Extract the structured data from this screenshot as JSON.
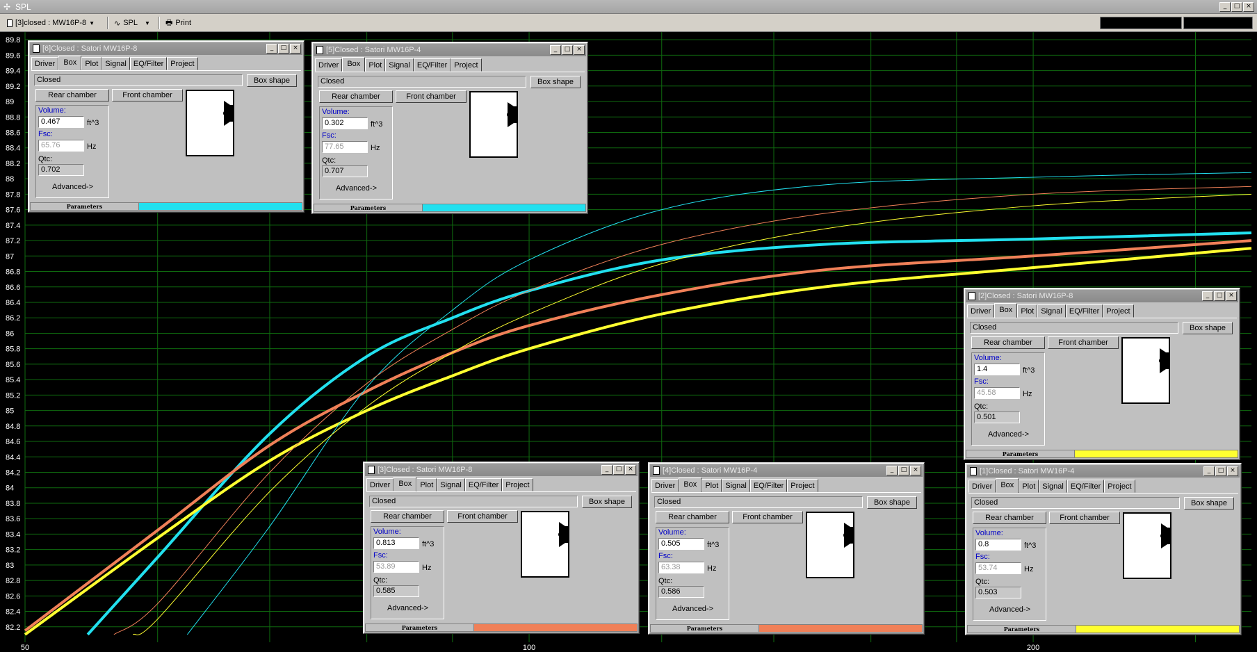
{
  "app": {
    "title": "SPL",
    "toolbar": {
      "project_select": "[3]closed : MW16P-8",
      "plot_select": "SPL",
      "print_label": "Print"
    }
  },
  "window_controls": {
    "minimize": "_",
    "maximize": "□",
    "close": "×"
  },
  "colors": {
    "cyan": "#22e0ef",
    "salmon": "#f08058",
    "yellow": "#ffff30",
    "grid": "#0f6b0f",
    "background": "#000000"
  },
  "chart_data": {
    "type": "line",
    "xscale": "log",
    "xlim": [
      50,
      270
    ],
    "ylim": [
      82,
      89.9
    ],
    "y_ticks": [
      "89.8",
      "89.6",
      "89.4",
      "89.2",
      "89",
      "88.8",
      "88.6",
      "88.4",
      "88.2",
      "88",
      "87.8",
      "87.6",
      "87.4",
      "87.2",
      "87",
      "86.8",
      "86.6",
      "86.4",
      "86.2",
      "86",
      "85.8",
      "85.6",
      "85.4",
      "85.2",
      "85",
      "84.8",
      "84.6",
      "84.4",
      "84.2",
      "84",
      "83.8",
      "83.6",
      "83.4",
      "83.2",
      "83",
      "82.8",
      "82.6",
      "82.4",
      "82.2"
    ],
    "x_ticks": [
      "50",
      "100",
      "200"
    ],
    "grid": true,
    "series": [
      {
        "color": "#22e0ef",
        "width": 4,
        "x": [
          54.5,
          60,
          70,
          80,
          90,
          100,
          120,
          150,
          200,
          270
        ],
        "y": [
          82.1,
          83.1,
          84.7,
          85.7,
          86.2,
          86.55,
          86.95,
          87.15,
          87.22,
          87.3
        ]
      },
      {
        "color": "#f08058",
        "width": 4,
        "x": [
          50,
          60,
          70,
          80,
          90,
          100,
          120,
          150,
          200,
          270
        ],
        "y": [
          82.15,
          83.45,
          84.55,
          85.25,
          85.75,
          86.1,
          86.5,
          86.82,
          87.0,
          87.2
        ]
      },
      {
        "color": "#ffff30",
        "width": 4,
        "x": [
          50,
          60,
          70,
          80,
          90,
          100,
          120,
          150,
          200,
          270
        ],
        "y": [
          82.1,
          83.35,
          84.35,
          85.0,
          85.45,
          85.8,
          86.25,
          86.6,
          86.85,
          87.1
        ]
      },
      {
        "color": "#22e0ef",
        "width": 1,
        "x": [
          62.5,
          70,
          80,
          90,
          100,
          120,
          150,
          200,
          270
        ],
        "y": [
          82.1,
          83.5,
          85.3,
          86.3,
          86.95,
          87.6,
          87.92,
          88.02,
          88.08
        ]
      },
      {
        "color": "#f08058",
        "width": 1,
        "x": [
          56.5,
          60,
          70,
          80,
          90,
          100,
          120,
          150,
          200,
          270
        ],
        "y": [
          82.1,
          82.5,
          84.2,
          85.35,
          86.05,
          86.55,
          87.15,
          87.55,
          87.8,
          87.9
        ]
      },
      {
        "color": "#ffff30",
        "width": 1,
        "x": [
          58,
          60,
          70,
          80,
          90,
          100,
          120,
          150,
          200,
          270
        ],
        "y": [
          82.1,
          82.3,
          83.95,
          85.05,
          85.75,
          86.25,
          86.9,
          87.35,
          87.65,
          87.8
        ]
      }
    ]
  },
  "panels": [
    {
      "title": "[6]Closed : Satori MW16P-8",
      "volume": "0.467",
      "fsc": "65.76",
      "qtc": "0.702",
      "color": "#22e0ef"
    },
    {
      "title": "[5]Closed : Satori MW16P-4",
      "volume": "0.302",
      "fsc": "77.65",
      "qtc": "0.707",
      "color": "#22e0ef"
    },
    {
      "title": "[2]Closed : Satori MW16P-8",
      "volume": "1.4",
      "fsc": "45.58",
      "qtc": "0.501",
      "color": "#ffff30"
    },
    {
      "title": "[3]Closed : Satori MW16P-8",
      "volume": "0.813",
      "fsc": "53.89",
      "qtc": "0.585",
      "color": "#f08058"
    },
    {
      "title": "[4]Closed : Satori MW16P-4",
      "volume": "0.505",
      "fsc": "63.38",
      "qtc": "0.586",
      "color": "#f08058"
    },
    {
      "title": "[1]Closed : Satori MW16P-4",
      "volume": "0.8",
      "fsc": "53.74",
      "qtc": "0.503",
      "color": "#ffff30"
    }
  ],
  "panel_labels": {
    "tabs": [
      "Driver",
      "Box",
      "Plot",
      "Signal",
      "EQ/Filter",
      "Project"
    ],
    "box_type": "Closed",
    "box_shape": "Box shape",
    "rear_chamber": "Rear chamber",
    "front_chamber": "Front chamber",
    "volume": "Volume:",
    "volume_unit": "ft^3",
    "fsc": "Fsc:",
    "fsc_unit": "Hz",
    "qtc": "Qtc:",
    "advanced": "Advanced->",
    "status": "Parameters"
  },
  "icons": {
    "speaker": "speaker-icon",
    "window": "window-icon",
    "printer": "printer-icon",
    "sine": "sine-wave-icon"
  }
}
